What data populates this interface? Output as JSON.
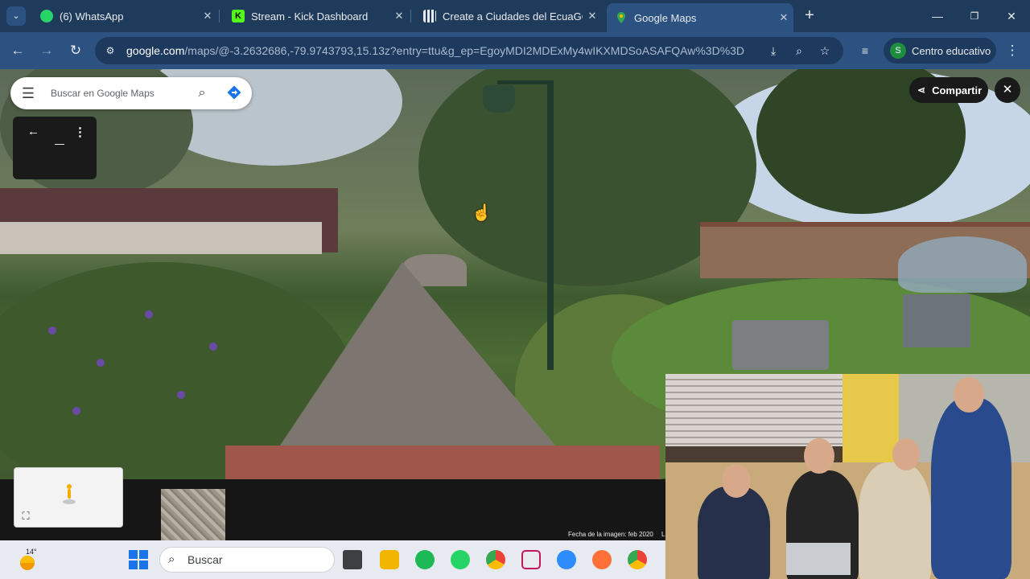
{
  "browser": {
    "tabs": [
      {
        "title": "(6) WhatsApp",
        "favicon": "whatsapp-icon",
        "color": "#25d366",
        "active": false
      },
      {
        "title": "Stream - Kick Dashboard",
        "favicon": "kick-icon",
        "color": "#53fc18",
        "active": false
      },
      {
        "title": "Create a Ciudades del EcuaGOE",
        "favicon": "dashboard-icon",
        "color": "#e8eaed",
        "active": false
      },
      {
        "title": "Google Maps",
        "favicon": "maps-pin-icon",
        "color": "#34a853",
        "active": true
      }
    ],
    "url_host": "google.com",
    "url_path": "/maps/@-3.2632686,-79.9743793,15.13z?entry=ttu&g_ep=EgoyMDI2MDExMy4wIKXMDSoASAFQAw%3D%3D",
    "profile_initial": "S",
    "profile_label": "Centro educativo"
  },
  "maps": {
    "search_placeholder": "Buscar en Google Maps",
    "share_label": "Compartir",
    "image_date": "Fecha de la imagen: feb 2020",
    "image_date_suffix": "L"
  },
  "taskbar": {
    "temperature": "14°",
    "search_placeholder": "Buscar",
    "apps": [
      "file-explorer-icon",
      "folder-icon",
      "spotify-icon",
      "whatsapp-icon",
      "chrome-icon",
      "snipping-tool-icon",
      "zoom-icon",
      "firefox-icon",
      "chrome-profile-icon"
    ]
  },
  "colors": {
    "tabstrip": "#1f3b5b",
    "toolbar": "#2b5281",
    "accent": "#34a853"
  }
}
